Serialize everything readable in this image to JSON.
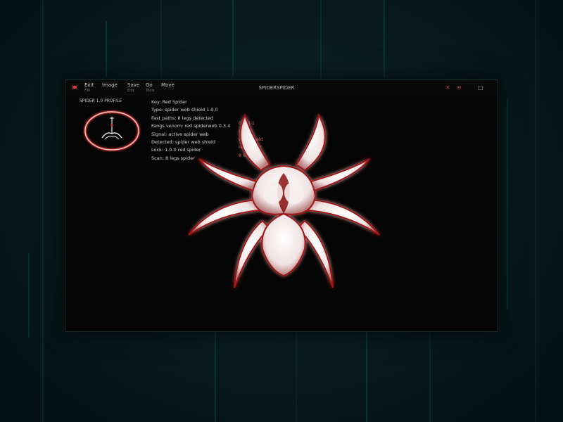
{
  "window": {
    "title": "SPIDERSPIDER"
  },
  "menu": [
    {
      "label": "Exit",
      "sub": "File"
    },
    {
      "label": "Image",
      "sub": ""
    },
    {
      "label": "Save",
      "sub": "Edit"
    },
    {
      "label": "Go",
      "sub": "Tools"
    },
    {
      "label": "Move",
      "sub": ""
    }
  ],
  "controls": {
    "close": "✕",
    "minimize": "⊝",
    "maximize": "□"
  },
  "logo": {
    "label": "SPIDER 1.0 PROFILE"
  },
  "info_lines": [
    "Key: Red Spider",
    "Type: spider web shield 1.0.0",
    "Fast paths: 8 legs detected",
    "Fangs venom: red spiderweb 0.3.4",
    "Signal: active spider web",
    "Detected: spider web shield",
    "Lock: 1.0.0 red spider",
    "Scan: 8 legs spider"
  ],
  "overlay_lines": [
    "0.0.0.1",
    "spider",
    "web shield",
    "red spider",
    "8 legs"
  ],
  "colors": {
    "accent": "#c04040",
    "glow": "#a01818",
    "spider": "#f1e4e4",
    "background": "#050505"
  },
  "icons": {
    "app": "spider-icon",
    "logo": "spider-emblem-icon"
  }
}
